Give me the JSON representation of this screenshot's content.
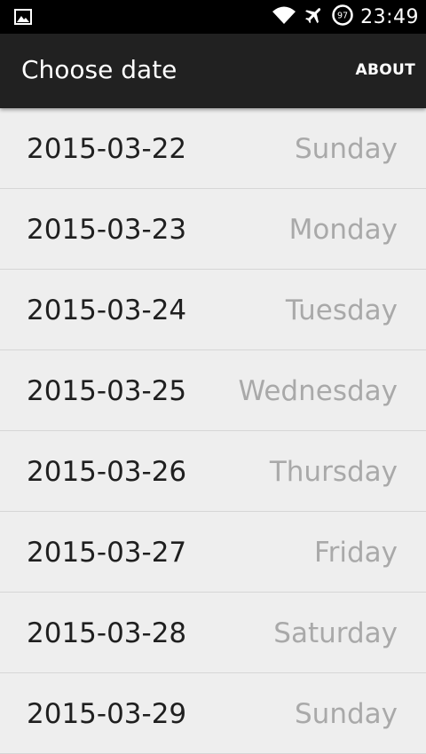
{
  "status_bar": {
    "time": "23:49",
    "battery_level": "97",
    "icons": [
      "gallery-notification-icon",
      "wifi-icon",
      "airplane-mode-icon",
      "battery-icon"
    ]
  },
  "action_bar": {
    "title": "Choose date",
    "about_label": "ABOUT"
  },
  "dates": [
    {
      "date": "2015-03-22",
      "day": "Sunday"
    },
    {
      "date": "2015-03-23",
      "day": "Monday"
    },
    {
      "date": "2015-03-24",
      "day": "Tuesday"
    },
    {
      "date": "2015-03-25",
      "day": "Wednesday"
    },
    {
      "date": "2015-03-26",
      "day": "Thursday"
    },
    {
      "date": "2015-03-27",
      "day": "Friday"
    },
    {
      "date": "2015-03-28",
      "day": "Saturday"
    },
    {
      "date": "2015-03-29",
      "day": "Sunday"
    }
  ],
  "colors": {
    "status_bar_bg": "#000000",
    "action_bar_bg": "#212121",
    "list_bg": "#eeeeee",
    "date_text": "#1f1f1f",
    "day_text": "#a9a9a9",
    "divider": "#d6d6d6"
  }
}
